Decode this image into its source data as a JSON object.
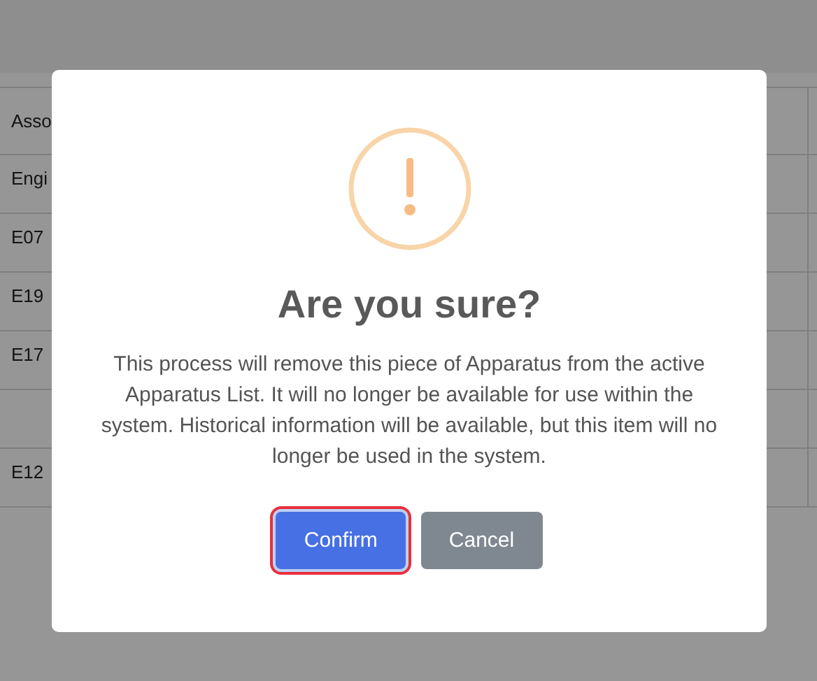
{
  "table": {
    "columns": [
      "Asso"
    ],
    "rows": [
      {
        "cells": [
          "Engi"
        ]
      },
      {
        "cells": [
          "E07"
        ]
      },
      {
        "cells": [
          "E19"
        ]
      },
      {
        "cells": [
          "E17"
        ]
      },
      {
        "cells": []
      },
      {
        "cells": [
          "E12"
        ]
      }
    ]
  },
  "dialog": {
    "title": "Are you sure?",
    "message": "This process will remove this piece of Apparatus from the active Apparatus List. It will no longer be available for use within the system. Historical information will be available, but this item will no longer be used in the system.",
    "buttons": [
      {
        "label": "Confirm",
        "kind": "confirm",
        "focused": true
      },
      {
        "label": "Cancel",
        "kind": "cancel",
        "focused": false
      }
    ]
  }
}
